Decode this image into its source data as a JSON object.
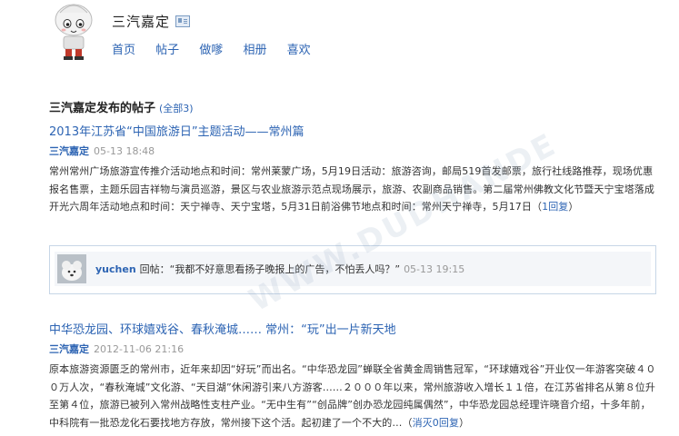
{
  "profile": {
    "name": "三汽嘉定"
  },
  "nav": [
    "首页",
    "帖子",
    "做嗲",
    "相册",
    "喜欢"
  ],
  "section": {
    "title": "三汽嘉定发布的帖子",
    "count": "(全部3)"
  },
  "posts": [
    {
      "title": "2013年江苏省“中国旅游日”主题活动——常州篇",
      "author": "三汽嘉定",
      "time": "05-13 18:48",
      "body": "常州常州广场旅游宣传推介活动地点和时间：常州莱蒙广场，5月19日活动：旅游咨询，邮局519首发邮票，旅行社线路推荐，现场优惠报名售票，主题乐园吉祥物与演员巡游，景区与农业旅游示范点现场展示，旅游、农副商品销售。第二届常州佛教文化节暨天宁宝塔落成开光六周年活动地点和时间：天宁禅寺、天宁宝塔，5月31日前浴佛节地点和时间：常州天宁禅寺，5月17日",
      "reply_link": "1回复"
    },
    {
      "title": "中华恐龙园、环球嬉戏谷、春秋淹城…… 常州：“玩”出一片新天地",
      "author": "三汽嘉定",
      "time": "2012-11-06 21:16",
      "body": "原本旅游资源匮乏的常州市，近年来却因“好玩”而出名。“中华恐龙园”蝉联全省黄金周销售冠军，“环球嬉戏谷”开业仅一年游客突破４００万人次，“春秋淹城”文化游、“天目湖”休闲游引来八方游客……２０００年以来，常州旅游收入增长１１倍，在江苏省排名从第８位升至第４位，旅游已被列入常州战略性支柱产业。“无中生有”“创品牌”创办恐龙园纯属偶然”，中华恐龙园总经理许晓音介绍，十多年前，中科院有一批恐龙化石要找地方存放，常州接下这个活。起初建了一个不大的…",
      "reply_link": "消灭0回复"
    }
  ],
  "reply": {
    "user": "yuchen",
    "prefix": "回帖：",
    "text": "“我都不好意思看扬子晚报上的广告，不怕丢人吗？”",
    "time": "05-13 19:15"
  },
  "watermark": "WWW.DUDHANDE"
}
